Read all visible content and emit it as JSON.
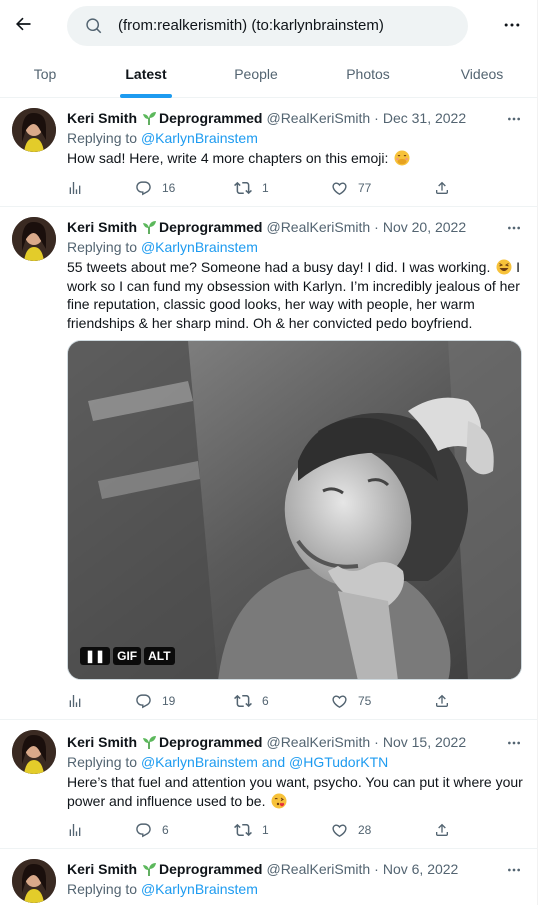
{
  "search": {
    "query": "(from:realkerismith) (to:karlynbrainstem)"
  },
  "tabs": [
    {
      "label": "Top"
    },
    {
      "label": "Latest"
    },
    {
      "label": "People"
    },
    {
      "label": "Photos"
    },
    {
      "label": "Videos"
    }
  ],
  "active_tab": "Latest",
  "colors": {
    "accent": "#1d9bf0",
    "text": "#0f1419",
    "secondary": "#536471"
  },
  "tweets": [
    {
      "name": "Keri Smith",
      "badge": "Deprogrammed",
      "handle": "@RealKeriSmith",
      "date": "Dec 31, 2022",
      "reply_prefix": "Replying to ",
      "reply_to": "@KarlynBrainstem",
      "text": "How sad! Here, write 4 more chapters on this emoji:",
      "emoji": "smiling-face-with-hand-over-mouth",
      "replies": "16",
      "retweets": "1",
      "likes": "77"
    },
    {
      "name": "Keri Smith",
      "badge": "Deprogrammed",
      "handle": "@RealKeriSmith",
      "date": "Nov 20, 2022",
      "reply_prefix": "Replying to ",
      "reply_to": "@KarlynBrainstem",
      "text_a": "55 tweets about me? Someone had a busy day! I did. I was working.",
      "text_b": "I work so I can fund my obsession with Karlyn. I’m incredibly jealous of her fine reputation, classic good looks, her way with people, her warm friendships  & her sharp mind. Oh & her convicted pedo boyfriend.",
      "media_badges": [
        "GIF",
        "ALT"
      ],
      "replies": "19",
      "retweets": "6",
      "likes": "75"
    },
    {
      "name": "Keri Smith",
      "badge": "Deprogrammed",
      "handle": "@RealKeriSmith",
      "date": "Nov 15, 2022",
      "reply_prefix": "Replying to ",
      "reply_to": "@KarlynBrainstem and @HGTudorKTN",
      "text": "Here’s that fuel and attention you want, psycho. You can put it where your power and influence used to be.",
      "emoji": "face-blowing-a-kiss",
      "replies": "6",
      "retweets": "1",
      "likes": "28"
    },
    {
      "name": "Keri Smith",
      "badge": "Deprogrammed",
      "handle": "@RealKeriSmith",
      "date": "Nov 6, 2022",
      "reply_prefix": "Replying to ",
      "reply_to": "@KarlynBrainstem"
    }
  ]
}
